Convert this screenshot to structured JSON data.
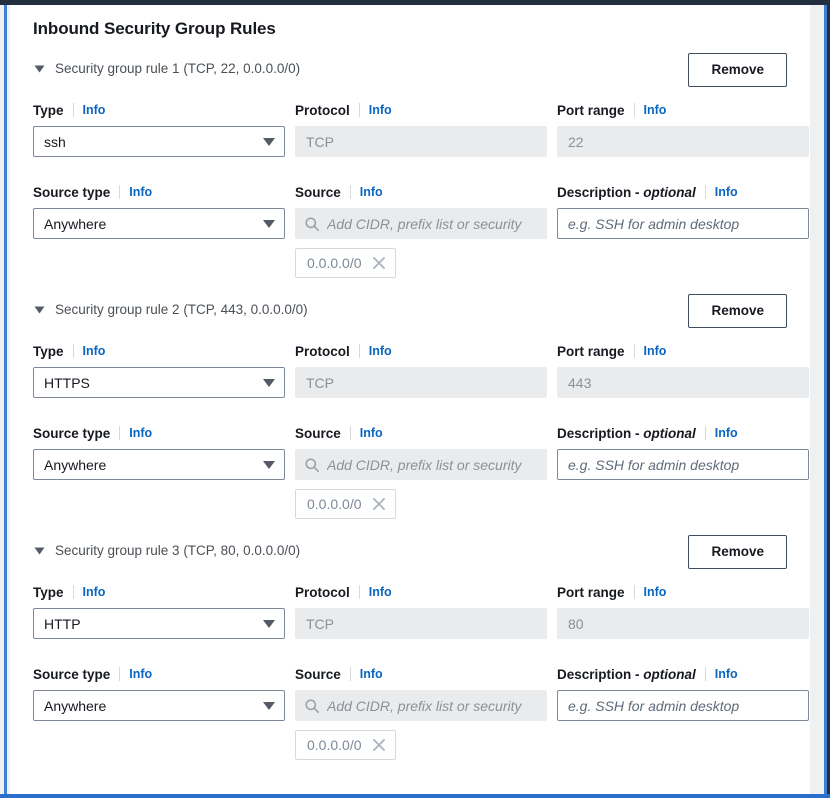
{
  "page": {
    "title": "Inbound Security Group Rules"
  },
  "labels": {
    "type": "Type",
    "protocol": "Protocol",
    "port_range": "Port range",
    "source_type": "Source type",
    "source": "Source",
    "description": "Description - ",
    "description_optional": "optional",
    "info": "Info",
    "remove": "Remove"
  },
  "placeholders": {
    "source": "Add CIDR, prefix list or security",
    "description": "e.g. SSH for admin desktop"
  },
  "icons": {
    "disclosure": "caret-down-icon",
    "select_arrow": "chevron-down-icon",
    "search": "search-icon",
    "token_remove": "close-icon"
  },
  "colors": {
    "info_link": "#0a66c2",
    "label_text": "#16191f",
    "summary_text": "#4a5056",
    "disabled_bg": "#e9ebed",
    "disabled_text": "#8a9198",
    "border": "#7d8998",
    "button_border": "#414d5c",
    "chrome_navy": "#232f3e",
    "chrome_blue": "#3f7fd4"
  },
  "rules": [
    {
      "summary": "Security group rule 1 (TCP, 22, 0.0.0.0/0)",
      "remove_label": "Remove",
      "type_value": "ssh",
      "protocol_value": "TCP",
      "port_value": "22",
      "source_type_value": "Anywhere",
      "source_token": "0.0.0.0/0",
      "description_value": ""
    },
    {
      "summary": "Security group rule 2 (TCP, 443, 0.0.0.0/0)",
      "remove_label": "Remove",
      "type_value": "HTTPS",
      "protocol_value": "TCP",
      "port_value": "443",
      "source_type_value": "Anywhere",
      "source_token": "0.0.0.0/0",
      "description_value": ""
    },
    {
      "summary": "Security group rule 3 (TCP, 80, 0.0.0.0/0)",
      "remove_label": "Remove",
      "type_value": "HTTP",
      "protocol_value": "TCP",
      "port_value": "80",
      "source_type_value": "Anywhere",
      "source_token": "0.0.0.0/0",
      "description_value": ""
    }
  ]
}
